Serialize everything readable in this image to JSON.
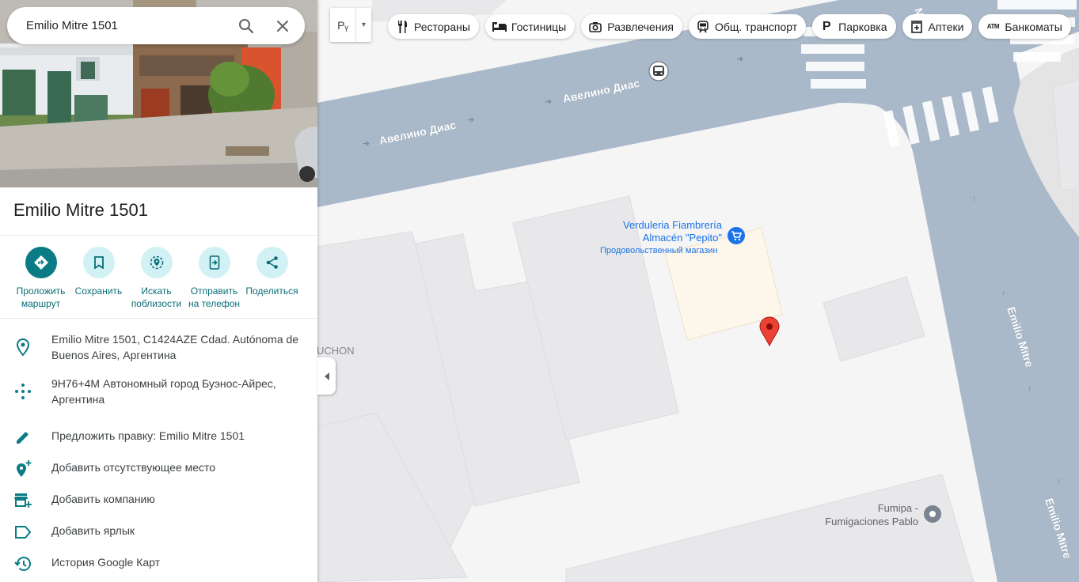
{
  "search": {
    "value": "Emilio Mitre 1501"
  },
  "place": {
    "title": "Emilio Mitre 1501"
  },
  "layer_selector": {
    "label": "Рᵧ"
  },
  "chips": [
    {
      "label": "Рестораны",
      "icon": "fork-knife-icon"
    },
    {
      "label": "Гостиницы",
      "icon": "bed-icon"
    },
    {
      "label": "Развлечения",
      "icon": "camera-icon"
    },
    {
      "label": "Общ. транспорт",
      "icon": "train-icon"
    },
    {
      "label": "Парковка",
      "icon": "parking-icon"
    },
    {
      "label": "Аптеки",
      "icon": "pharmacy-icon"
    },
    {
      "label": "Банкоматы",
      "icon": "atm-icon"
    }
  ],
  "actions": [
    {
      "label": "Проложить маршрут",
      "icon": "directions-icon"
    },
    {
      "label": "Сохранить",
      "icon": "bookmark-icon"
    },
    {
      "label": "Искать поблизости",
      "icon": "nearby-icon"
    },
    {
      "label": "Отправить на телефон",
      "icon": "send-to-phone-icon"
    },
    {
      "label": "Поделиться",
      "icon": "share-icon"
    }
  ],
  "info_rows": [
    {
      "text": "Emilio Mitre 1501, C1424AZE Cdad. Autónoma de Buenos Aires, Аргентина",
      "icon": "location-pin-icon"
    },
    {
      "text": "9H76+4M Автономный город Буэнос-Айрес, Аргентина",
      "icon": "plus-code-icon"
    },
    {
      "text": "Предложить правку: Emilio Mitre 1501",
      "icon": "edit-pencil-icon"
    },
    {
      "text": "Добавить отсутствующее место",
      "icon": "add-place-icon"
    },
    {
      "text": "Добавить компанию",
      "icon": "add-business-icon"
    },
    {
      "text": "Добавить ярлык",
      "icon": "label-icon"
    },
    {
      "text": "История Google Карт",
      "icon": "history-icon"
    }
  ],
  "map": {
    "streets": {
      "avelino_1": "Авелино Диас",
      "avelino_2": "Авелино Диас",
      "emilio_1": "Emilio Mitre",
      "emilio_2": "Emilio Mitre",
      "partial_top": "М"
    },
    "poi_verduleria": {
      "name_line1": "Verduleria Fiambrería",
      "name_line2": "Almacén \"Pepito\"",
      "category": "Продовольственный магазин"
    },
    "poi_fumipa": {
      "name_line1": "Fumipa -",
      "name_line2": "Fumigaciones Pablo"
    },
    "partial_label": "UCHON"
  },
  "colors": {
    "accent": "#0b7c85",
    "road": "#aab9c9",
    "building": "#e8e8ea",
    "pin": "#ea4335"
  }
}
